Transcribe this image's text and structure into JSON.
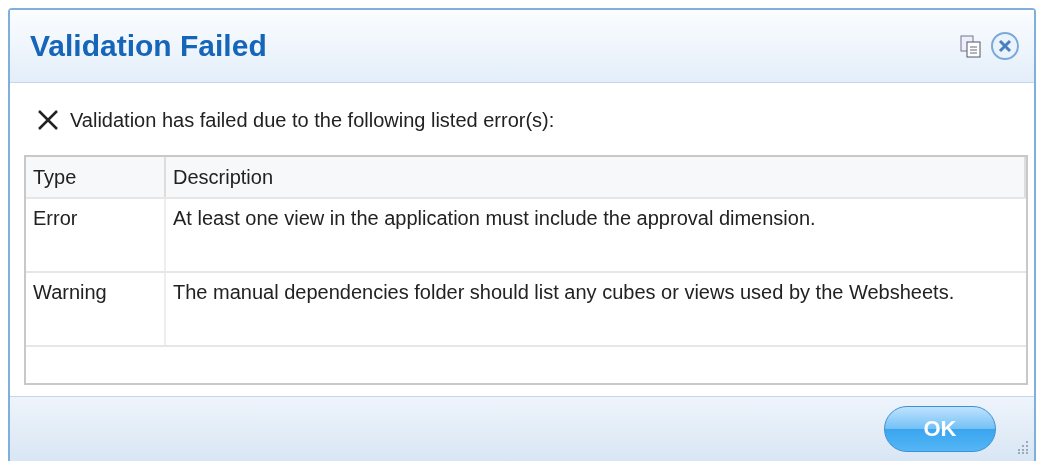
{
  "window": {
    "title": "Validation Failed"
  },
  "message": "Validation has failed due to the following listed error(s):",
  "table": {
    "columns": [
      "Type",
      "Description"
    ],
    "rows": [
      {
        "type": "Error",
        "description": "At least one view in the application must include the approval dimension."
      },
      {
        "type": "Warning",
        "description": "The manual dependencies folder should list any cubes or views used by the Websheets."
      }
    ]
  },
  "buttons": [
    "OK"
  ]
}
